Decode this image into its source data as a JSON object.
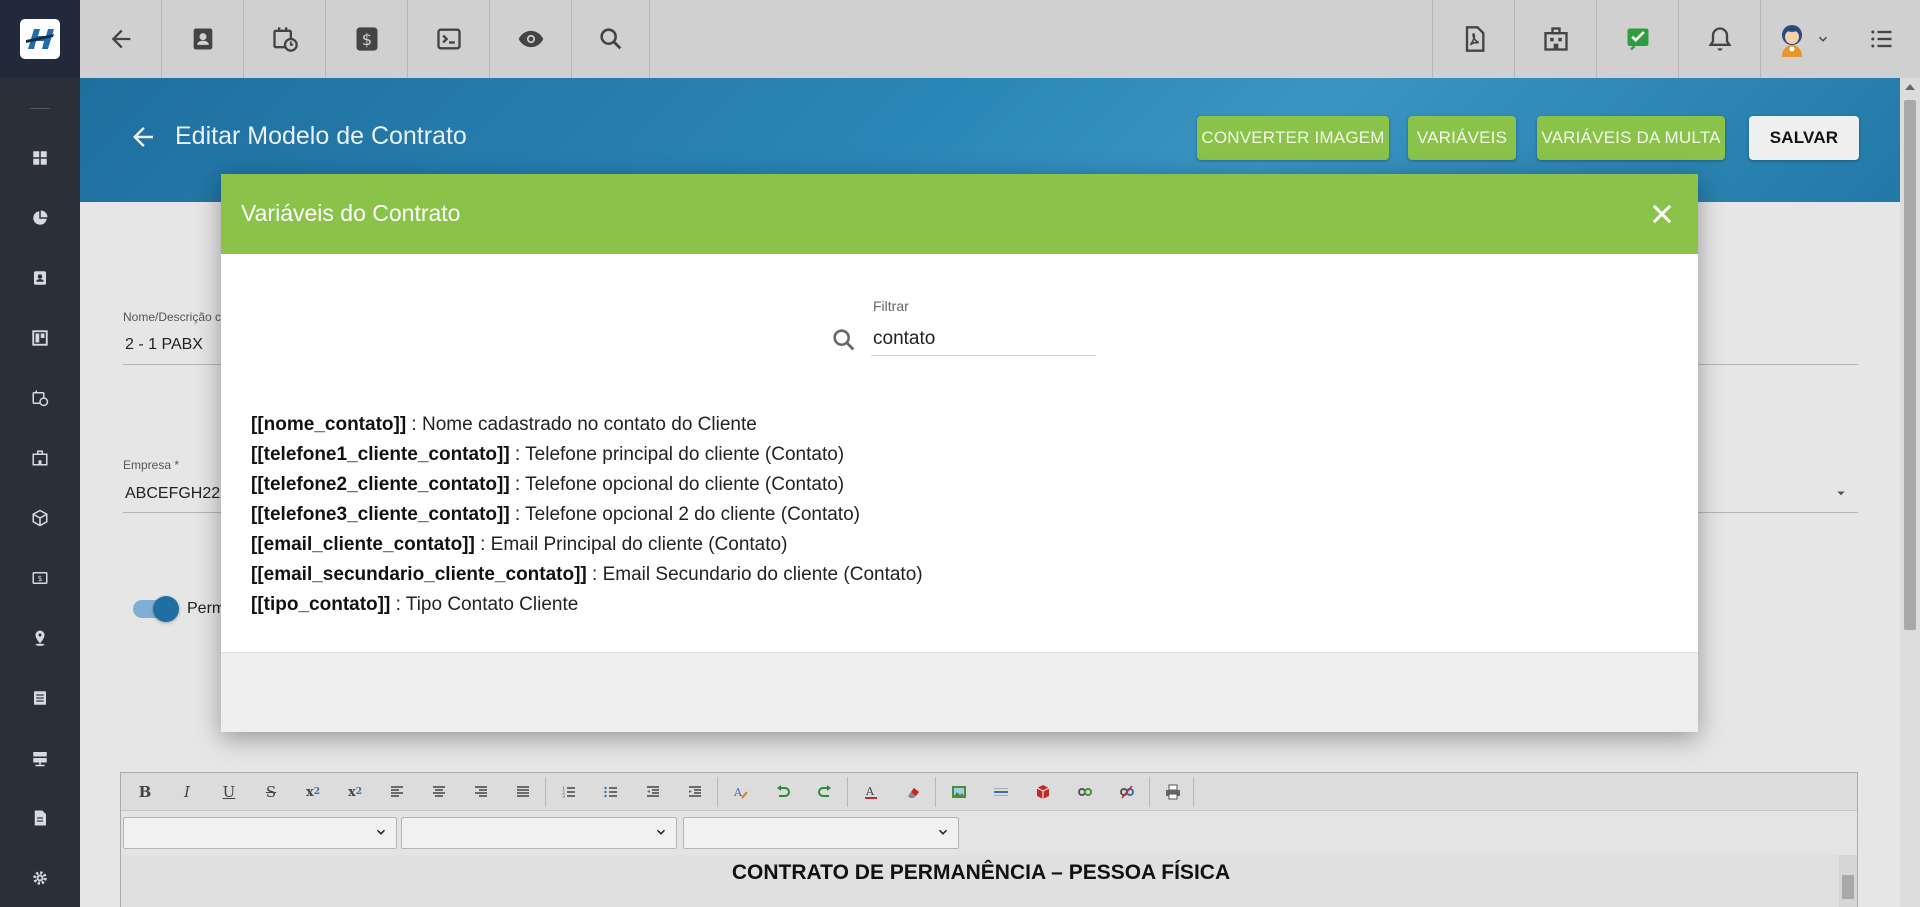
{
  "topbar": {
    "icons": [
      "back-arrow-icon",
      "contact-card-icon",
      "calendar-clock-icon",
      "dollar-icon",
      "terminal-icon",
      "eye-icon",
      "search-icon"
    ],
    "right_icons": [
      "pdf-icon",
      "building-icon",
      "check-icon",
      "bell-icon",
      "avatar",
      "menu-list-icon"
    ],
    "check_color": "#2e9e3e"
  },
  "sidebar": {
    "icons": [
      "dashboard-icon",
      "pie-chart-icon",
      "contact-icon",
      "board-icon",
      "calendar-icon",
      "building-icon",
      "package-icon",
      "money-icon",
      "map-pin-icon",
      "list-icon",
      "server-icon",
      "document-icon",
      "settings-icon"
    ]
  },
  "header": {
    "title": "Editar Modelo de Contrato",
    "buttons": {
      "convert": "CONVERTER IMAGEM",
      "variables": "VARIÁVEIS",
      "fine_variables": "VARIÁVEIS DA MULTA",
      "save": "SALVAR"
    }
  },
  "form": {
    "name_label": "Nome/Descrição c",
    "name_value": "2 - 1 PABX",
    "company_label": "Empresa *",
    "company_value": "ABCEFGH222",
    "toggle_label": "Perm"
  },
  "editor": {
    "heading": "CONTRATO DE PERMANÊNCIA – PESSOA FÍSICA"
  },
  "modal": {
    "title": "Variáveis do Contrato",
    "filter_label": "Filtrar",
    "filter_value": "contato",
    "variables": [
      {
        "key": "[[nome_contato]]",
        "desc": " : Nome cadastrado no contato do Cliente"
      },
      {
        "key": "[[telefone1_cliente_contato]]",
        "desc": " : Telefone principal do cliente (Contato)"
      },
      {
        "key": "[[telefone2_cliente_contato]]",
        "desc": " : Telefone opcional do cliente (Contato)"
      },
      {
        "key": "[[telefone3_cliente_contato]]",
        "desc": " : Telefone opcional 2 do cliente (Contato)"
      },
      {
        "key": "[[email_cliente_contato]]",
        "desc": " : Email Principal do cliente (Contato)"
      },
      {
        "key": "[[email_secundario_cliente_contato]]",
        "desc": " : Email Secundario do cliente (Contato)"
      },
      {
        "key": "[[tipo_contato]]",
        "desc": " : Tipo Contato Cliente"
      }
    ]
  },
  "colors": {
    "accent_green": "#8bc34a",
    "header_blue": "#2a86b6",
    "sidebar": "#2b3038"
  }
}
